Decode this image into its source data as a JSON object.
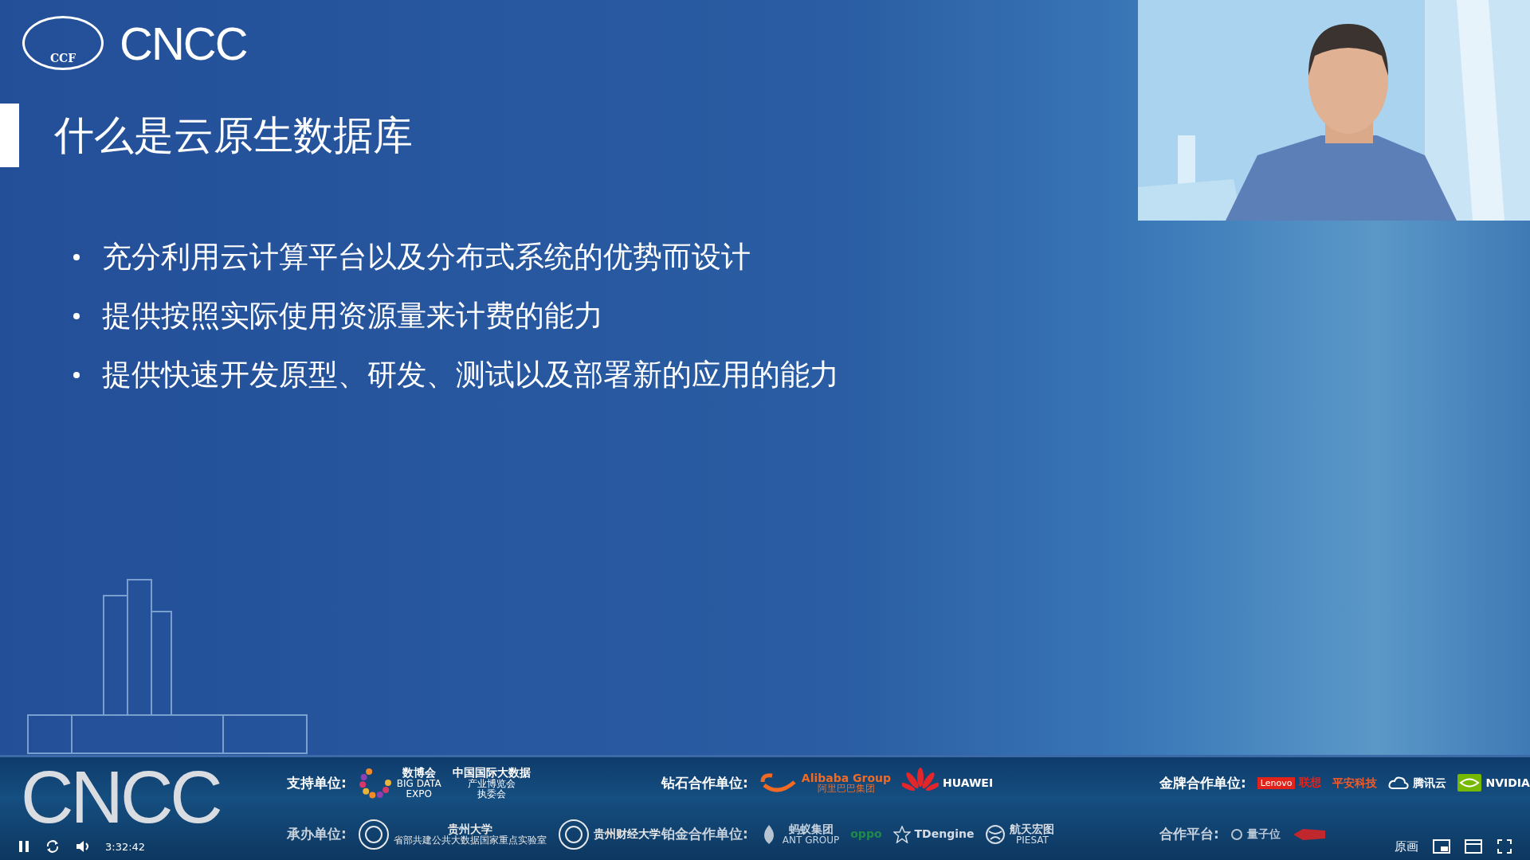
{
  "header": {
    "org_badge": "CCF",
    "logo_text": "CNCC"
  },
  "slide": {
    "title": "什么是云原生数据库",
    "bullets": [
      "充分利用云计算平台以及分布式系统的优势而设计",
      "提供按照实际使用资源量来计费的能力",
      "提供快速开发原型、研发、测试以及部署新的应用的能力"
    ]
  },
  "banner": {
    "logo_text": "CNCC",
    "rows": [
      [
        {
          "label": "支持单位:",
          "sponsors": [
            {
              "kind": "dots",
              "texts": [
                "数博会",
                "BIG DATA",
                "EXPO"
              ],
              "color": "#ffffff"
            },
            {
              "kind": "plain",
              "texts": [
                "中国国际大数据",
                "产业博览会",
                "执委会"
              ],
              "color": "#ffffff"
            }
          ]
        },
        {
          "label": "钻石合作单位:",
          "sponsors": [
            {
              "kind": "smile",
              "texts": [
                "Alibaba Group",
                "阿里巴巴集团"
              ],
              "color": "#f06a23"
            },
            {
              "kind": "petals",
              "texts": [
                "HUAWEI"
              ],
              "color": "#ffffff"
            }
          ]
        },
        {
          "label": "金牌合作单位:",
          "sponsors": [
            {
              "kind": "tag",
              "texts": [
                "Lenovo",
                "联想"
              ],
              "color": "#e2231a"
            },
            {
              "kind": "plain",
              "texts": [
                "平安科技"
              ],
              "color": "#f05a28"
            },
            {
              "kind": "cloud",
              "texts": [
                "腾讯云"
              ],
              "color": "#ffffff"
            },
            {
              "kind": "eye",
              "texts": [
                "NVIDIA"
              ],
              "color": "#ffffff"
            }
          ]
        }
      ],
      [
        {
          "label": "承办单位:",
          "sponsors": [
            {
              "kind": "seal",
              "texts": [
                "贵州大学",
                "省部共建公共大数据国家重点实验室"
              ],
              "color": "#e8e8e8"
            },
            {
              "kind": "seal",
              "texts": [
                "贵州财经大学"
              ],
              "color": "#e8e8e8"
            }
          ]
        },
        {
          "label": "铂金合作单位:",
          "sponsors": [
            {
              "kind": "drop",
              "texts": [
                "蚂蚁集团",
                "ANT GROUP"
              ],
              "color": "#c9d3de"
            },
            {
              "kind": "plain",
              "texts": [
                "oppo"
              ],
              "color": "#1f8a4c"
            },
            {
              "kind": "star",
              "texts": [
                "TDengine"
              ],
              "color": "#d6dde6"
            },
            {
              "kind": "globe",
              "texts": [
                "航天宏图",
                "PIESAT"
              ],
              "color": "#d6dde6"
            }
          ]
        },
        {
          "label": "合作平台:",
          "sponsors": [
            {
              "kind": "ring",
              "texts": [
                "量子位"
              ],
              "color": "#b8c4d2"
            },
            {
              "kind": "mark",
              "color": "#c0282d"
            }
          ]
        }
      ]
    ]
  },
  "player": {
    "time": "3:32:42",
    "quality": "原画",
    "playing": true
  }
}
